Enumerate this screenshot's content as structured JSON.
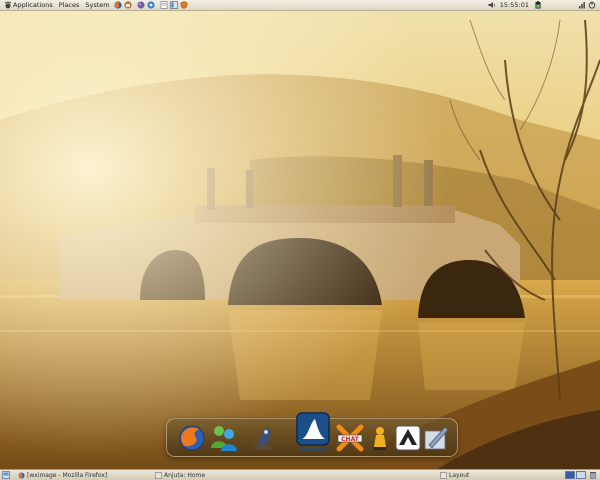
{
  "top_panel": {
    "menus": [
      "Applications",
      "Places",
      "System"
    ],
    "launcher_icons": [
      "firefox-icon",
      "thunderbird-icon",
      "pidgin-icon",
      "help-icon",
      "text-editor-icon",
      "web-icon",
      "firewall-icon"
    ],
    "status_icons": [
      "volume-icon",
      "battery-icon",
      "network-icon"
    ],
    "clock": "15:55:01"
  },
  "dock": {
    "items": [
      "firefox-icon",
      "messenger-icon",
      "gimp-icon",
      "wireshark-icon",
      "xchat-icon",
      "vlc-icon",
      "inkscape-icon",
      "tools-icon"
    ]
  },
  "bottom_panel": {
    "tasks": [
      {
        "label": "[wximage - Mozilla Firefox]"
      },
      {
        "label": "Anjuta: Home"
      },
      {
        "label": "Layout"
      }
    ],
    "workspaces": 2,
    "colors": {
      "accent": "#2f5fa8"
    }
  }
}
